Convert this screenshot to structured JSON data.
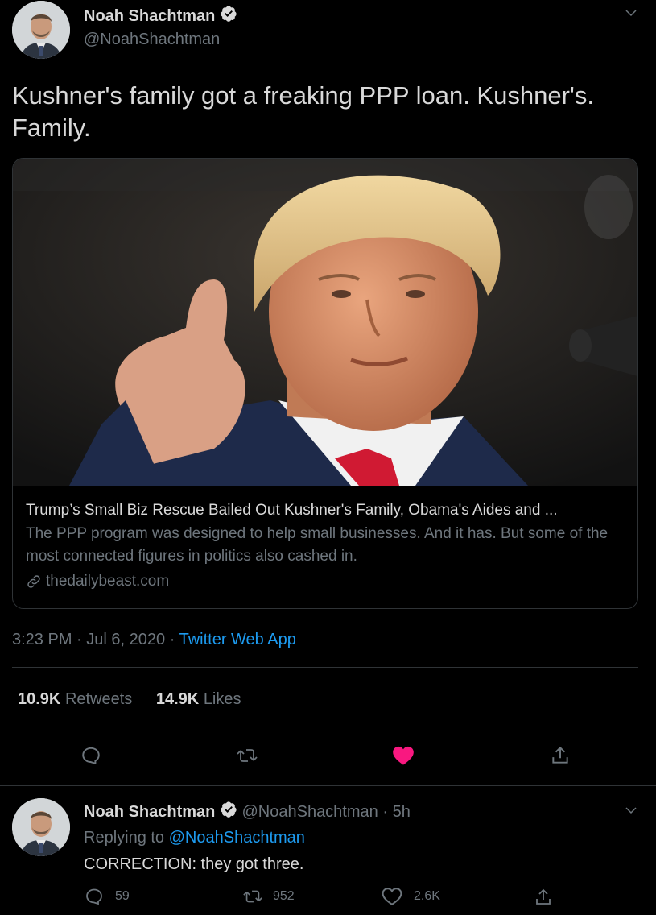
{
  "tweet": {
    "author_name": "Noah Shachtman",
    "author_handle": "@NoahShachtman",
    "text": "Kushner's family got a freaking PPP loan. Kushner's. Family.",
    "card": {
      "title": "Trump’s Small Biz Rescue Bailed Out Kushner's Family, Obama's Aides and ...",
      "description": "The PPP program was designed to help small businesses. And it has. But some of the most connected figures in politics also cashed in.",
      "domain": "thedailybeast.com"
    },
    "time": "3:23 PM",
    "date": "Jul 6, 2020",
    "separator": "·",
    "source": "Twitter Web App",
    "retweets_count": "10.9K",
    "retweets_label": "Retweets",
    "likes_count": "14.9K",
    "likes_label": "Likes",
    "colors": {
      "like_active": "#f91880",
      "link": "#1d9bf0"
    }
  },
  "reply": {
    "author_name": "Noah Shachtman",
    "author_handle": "@NoahShachtman",
    "separator": "·",
    "age": "5h",
    "replying_to_label": "Replying to",
    "replying_to_handle": "@NoahShachtman",
    "text": "CORRECTION: they got three.",
    "reply_count": "59",
    "retweet_count": "952",
    "like_count": "2.6K"
  }
}
